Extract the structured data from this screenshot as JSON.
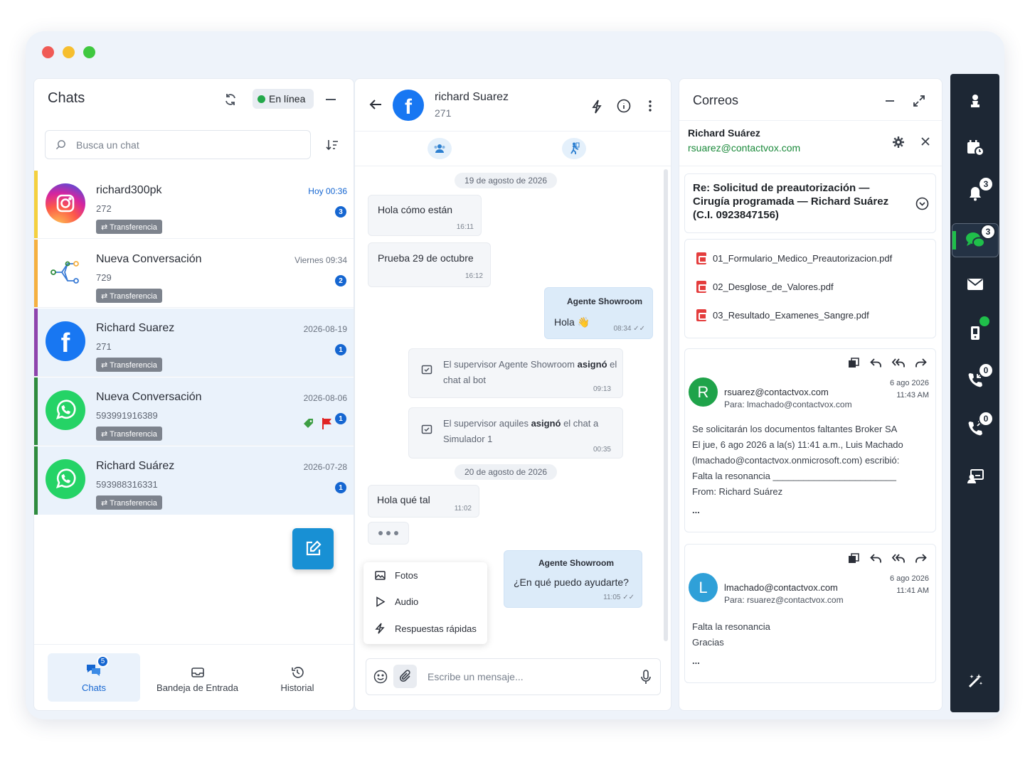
{
  "chats_panel": {
    "title": "Chats",
    "status": "En línea",
    "search_placeholder": "Busca un chat",
    "items": [
      {
        "name": "richard300pk",
        "number": "272",
        "tag": "⇄ Transferencia",
        "time": "Hoy 00:36",
        "count": "3",
        "channel": "instagram",
        "bar_color": "#f4d03f"
      },
      {
        "name": "Nueva Conversación",
        "number": "729",
        "tag": "⇄ Transferencia",
        "time": "Viernes 09:34",
        "count": "2",
        "channel": "bot",
        "bar_color": "#f5b041"
      },
      {
        "name": "Richard Suarez",
        "number": "271",
        "tag": "⇄ Transferencia",
        "time": "2026-08-19",
        "count": "1",
        "channel": "facebook",
        "bar_color": "#8e44ad"
      },
      {
        "name": "Nueva Conversación",
        "number": "593991916389",
        "tag": "⇄ Transferencia",
        "time": "2026-08-06",
        "count": "1",
        "channel": "whatsapp",
        "bar_color": "#2e8b3e"
      },
      {
        "name": "Richard Suárez",
        "number": "593988316331",
        "tag": "⇄ Transferencia",
        "time": "2026-07-28",
        "count": "1",
        "channel": "whatsapp",
        "bar_color": "#2e8b3e"
      }
    ],
    "nav": {
      "chats": "Chats",
      "chats_badge": "5",
      "inbox": "Bandeja de Entrada",
      "history": "Historial"
    }
  },
  "conversation": {
    "contact_name": "richard Suarez",
    "contact_number": "271",
    "dates": [
      "19 de agosto de 2026",
      "20 de agosto de 2026"
    ],
    "messages": [
      {
        "text": "Hola cómo están",
        "time": "16:11"
      },
      {
        "text": "Prueba 29 de octubre",
        "time": "16:12"
      },
      {
        "sender": "Agente Showroom",
        "text": "Hola 👋",
        "time": "08:34 ✓✓"
      },
      {
        "sys_a": "El supervisor Agente Showroom ",
        "sys_b": "asignó",
        "sys_c": " el chat al bot",
        "time": "09:13"
      },
      {
        "sys_a": "El supervisor aquiles ",
        "sys_b": "asignó",
        "sys_c": " el chat a Simulador 1",
        "time": "00:35"
      },
      {
        "text": "Hola qué tal",
        "time": "11:02"
      },
      {
        "sender": "Agente Showroom",
        "text": "¿En qué puedo ayudarte?",
        "time": "11:05 ✓✓"
      }
    ],
    "attach_menu": [
      "Fotos",
      "Audio",
      "Respuestas rápidas"
    ],
    "input_placeholder": "Escribe un mensaje..."
  },
  "mail": {
    "title": "Correos",
    "contact_name": "Richard Suárez",
    "contact_email": "rsuarez@contactvox.com",
    "subject": "Re: Solicitud de preautorización — Cirugía programada — Richard Suárez (C.I. 0923847156)",
    "files": [
      "01_Formulario_Medico_Preautorizacion.pdf",
      "02_Desglose_de_Valores.pdf",
      "03_Resultado_Examenes_Sangre.pdf"
    ],
    "emails": [
      {
        "initial": "R",
        "avatar_color": "#1fa34a",
        "from": "rsuarez@contactvox.com",
        "to": "Para: lmachado@contactvox.com",
        "date": "6 ago 2026",
        "time": "11:43 AM",
        "body": [
          "Se solicitarán los documentos faltantes Broker SA",
          "El jue, 6 ago 2026 a la(s) 11:41 a.m., Luis Machado",
          "(lmachado@contactvox.onmicrosoft.com) escribió:",
          "Falta la resonancia ________________________",
          "From: Richard Suárez"
        ],
        "more": "..."
      },
      {
        "initial": "L",
        "avatar_color": "#2fa0d8",
        "from": "lmachado@contactvox.com",
        "to": "Para: rsuarez@contactvox.com",
        "date": "6 ago 2026",
        "time": "11:41 AM",
        "body": [
          "Falta la resonancia",
          "Gracias"
        ],
        "more": "..."
      }
    ]
  },
  "rail": {
    "notifications": "3",
    "chats": "3",
    "calls_in": "0",
    "calls_out": "0"
  },
  "colors": {
    "accent": "#1566d1",
    "fab": "#1890d4",
    "rail": "#1d2734",
    "online": "#23a84a"
  }
}
